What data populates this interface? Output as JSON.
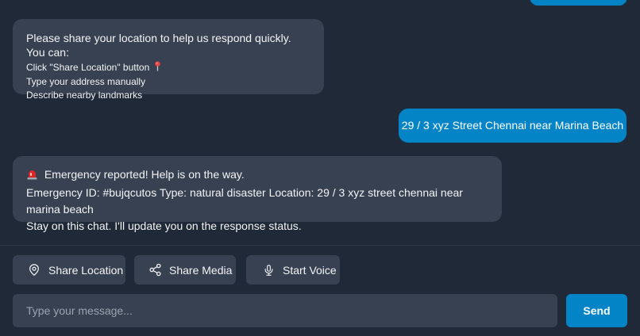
{
  "colors": {
    "background": "#1f2937",
    "bot_bubble": "#374151",
    "user_bubble": "#0284c7",
    "accent": "#0284c7",
    "text": "#f3f4f6",
    "placeholder": "#9ca3af"
  },
  "messages": {
    "bot_location_request": {
      "lead": "Please share your location to help us respond quickly. You can:",
      "options": [
        {
          "text": "Click \"Share Location\" button",
          "icon": "pin-icon"
        },
        {
          "text": "Type your address manually"
        },
        {
          "text": "Describe nearby landmarks"
        }
      ]
    },
    "user_address": {
      "text": "29 / 3 xyz Street Chennai near Marina Beach"
    },
    "bot_confirmation": {
      "icon": "siren-icon",
      "line1": "Emergency reported! Help is on the way.",
      "line2": "Emergency ID: #bujqcutos Type: natural disaster Location: 29 / 3 xyz street chennai near marina beach",
      "line3": "Stay on this chat. I'll update you on the response status."
    }
  },
  "actions": {
    "share_location": {
      "label": "Share Location",
      "icon": "map-pin-icon"
    },
    "share_media": {
      "label": "Share Media",
      "icon": "share-icon"
    },
    "start_voice": {
      "label": "Start Voice",
      "icon": "microphone-icon"
    }
  },
  "composer": {
    "placeholder": "Type your message...",
    "value": "",
    "send_label": "Send"
  }
}
